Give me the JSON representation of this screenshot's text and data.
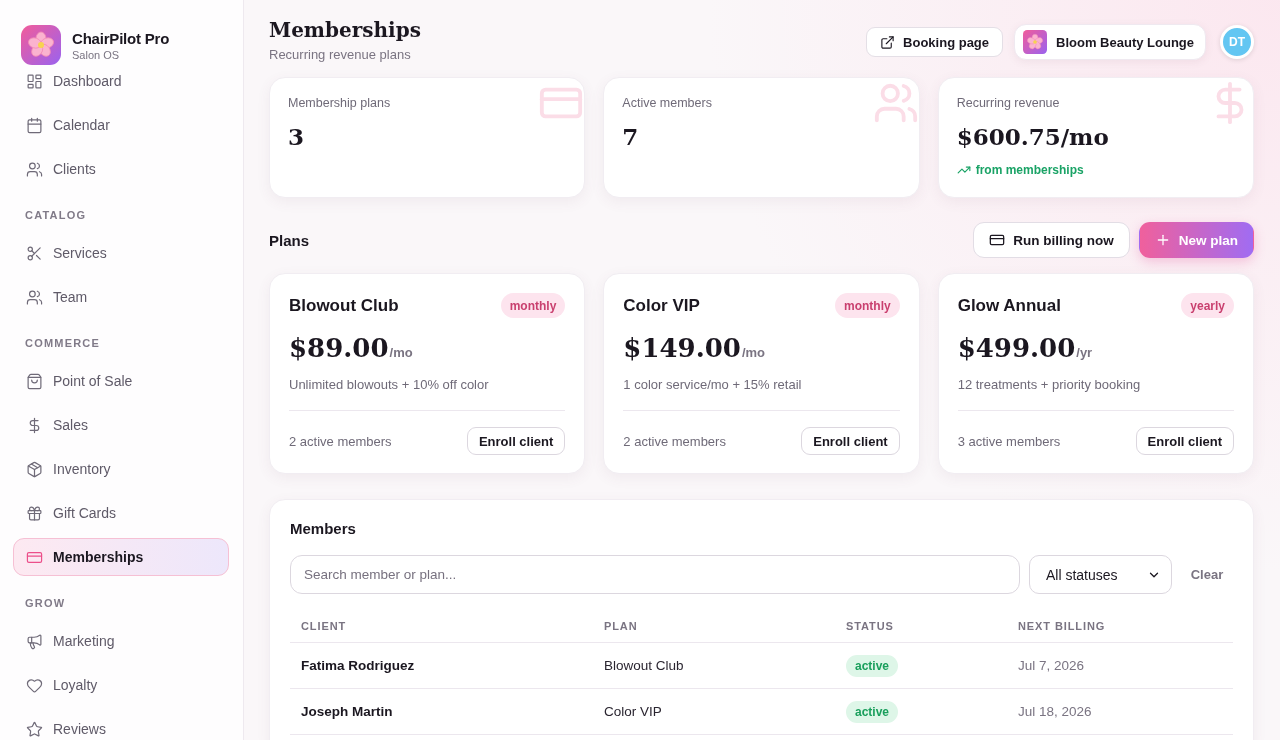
{
  "sidebar": {
    "brand": {
      "name": "ChairPilot Pro",
      "subtitle": "Salon OS"
    },
    "sections": [
      {
        "items": [
          {
            "label": "Dashboard",
            "selected": false
          },
          {
            "label": "Calendar",
            "selected": false
          },
          {
            "label": "Clients",
            "selected": false
          }
        ]
      },
      {
        "heading": "CATALOG",
        "items": [
          {
            "label": "Services",
            "selected": false
          },
          {
            "label": "Team",
            "selected": false
          }
        ]
      },
      {
        "heading": "COMMERCE",
        "items": [
          {
            "label": "Point of Sale",
            "selected": false
          },
          {
            "label": "Sales",
            "selected": false
          },
          {
            "label": "Inventory",
            "selected": false
          },
          {
            "label": "Gift Cards",
            "selected": false
          },
          {
            "label": "Memberships",
            "selected": true
          }
        ]
      },
      {
        "heading": "GROW",
        "items": [
          {
            "label": "Marketing",
            "selected": false
          },
          {
            "label": "Loyalty",
            "selected": false
          },
          {
            "label": "Reviews",
            "selected": false
          }
        ]
      }
    ]
  },
  "header": {
    "title": "Memberships",
    "subtitle": "Recurring revenue plans",
    "booking_button": "Booking page",
    "location": "Bloom Beauty Lounge",
    "avatar": "DT"
  },
  "stats": [
    {
      "label": "Membership plans",
      "value": "3"
    },
    {
      "label": "Active members",
      "value": "7"
    },
    {
      "label": "Recurring revenue",
      "value": "$600.75/mo",
      "note": "from memberships"
    }
  ],
  "plans_section": {
    "title": "Plans",
    "buttons": [
      {
        "label": "Run billing now",
        "kind": "secondary"
      },
      {
        "label": "New plan",
        "kind": "primary"
      }
    ]
  },
  "plans": [
    {
      "name": "Blowout Club",
      "period": "monthly",
      "price": "$89.00",
      "unit": "/mo",
      "description": "Unlimited blowouts + 10% off color",
      "members": "2 active members",
      "action": "Enroll client"
    },
    {
      "name": "Color VIP",
      "period": "monthly",
      "price": "$149.00",
      "unit": "/mo",
      "description": "1 color service/mo + 15% retail",
      "members": "2 active members",
      "action": "Enroll client"
    },
    {
      "name": "Glow Annual",
      "period": "yearly",
      "price": "$499.00",
      "unit": "/yr",
      "description": "12 treatments + priority booking",
      "members": "3 active members",
      "action": "Enroll client"
    }
  ],
  "members": {
    "title": "Members",
    "search": {
      "placeholder": "Search member or plan..."
    },
    "filter": {
      "value": "All statuses"
    },
    "clear": "Clear",
    "columns": [
      "CLIENT",
      "PLAN",
      "STATUS",
      "NEXT BILLING"
    ],
    "rows": [
      {
        "client": "Fatima Rodriguez",
        "plan": "Blowout Club",
        "status": "active",
        "next_billing": "Jul 7, 2026"
      },
      {
        "client": "Joseph Martin",
        "plan": "Color VIP",
        "status": "active",
        "next_billing": "Jul 18, 2026"
      }
    ]
  }
}
